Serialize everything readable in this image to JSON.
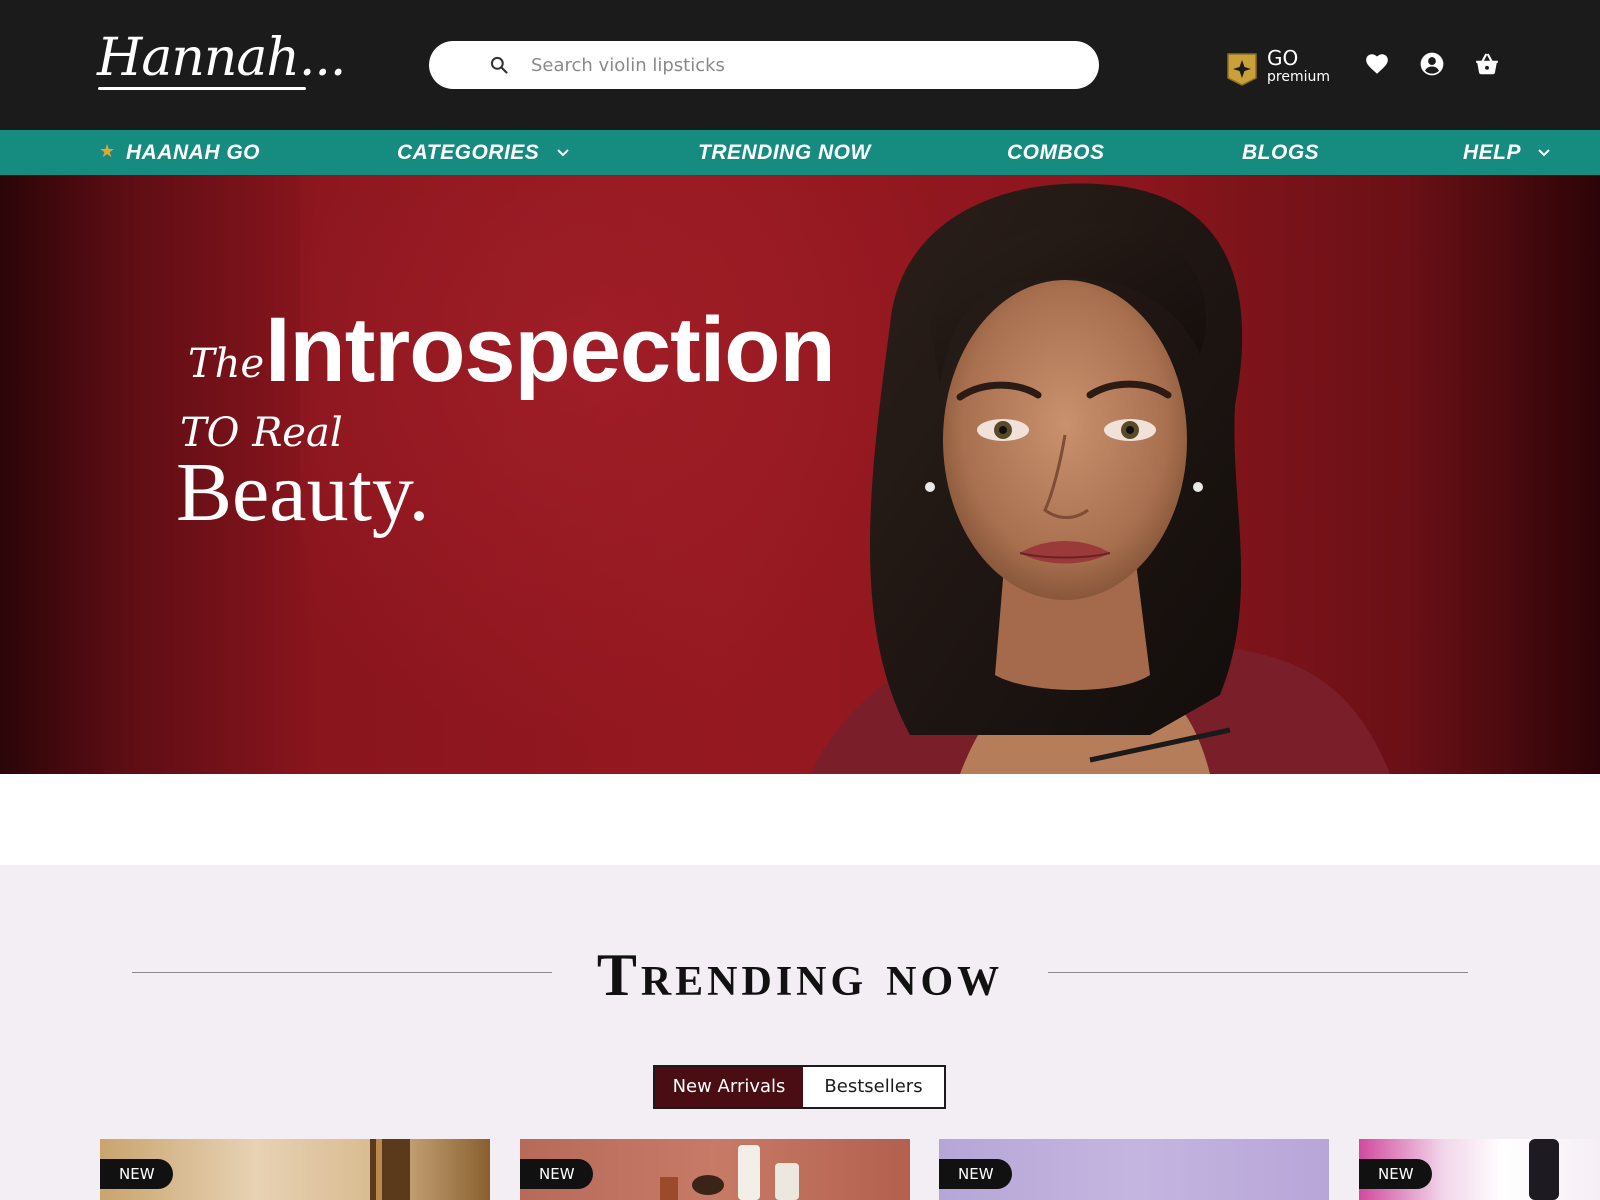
{
  "header": {
    "logo_text": "Hannah...",
    "search": {
      "placeholder": "Search violin lipsticks",
      "value": ""
    },
    "premium": {
      "title": "GO",
      "subtitle": "premium"
    },
    "icons": [
      "heart-icon",
      "user-icon",
      "basket-icon"
    ]
  },
  "nav": {
    "items": [
      {
        "label": "HAANAH GO"
      },
      {
        "label": "CATEGORIES"
      },
      {
        "label": "TRENDING NOW"
      },
      {
        "label": "COMBOS"
      },
      {
        "label": "BLOGS"
      },
      {
        "label": "HELP"
      }
    ]
  },
  "hero": {
    "line1_script": "The",
    "line1_main": "Introspection",
    "line2_script": "TO Real",
    "line3": "Beauty."
  },
  "trending": {
    "title": "Trending now",
    "tabs": [
      {
        "label": "New Arrivals",
        "active": true
      },
      {
        "label": "Bestsellers",
        "active": false
      }
    ],
    "cards": [
      {
        "badge": "NEW"
      },
      {
        "badge": "NEW"
      },
      {
        "badge": "NEW"
      },
      {
        "badge": "NEW"
      }
    ]
  },
  "colors": {
    "header_bg": "#1c1b1b",
    "nav_bg": "#168c80",
    "hero_red": "#951820",
    "active_tab": "#4a0d14",
    "section_bg": "#f3eef3"
  }
}
